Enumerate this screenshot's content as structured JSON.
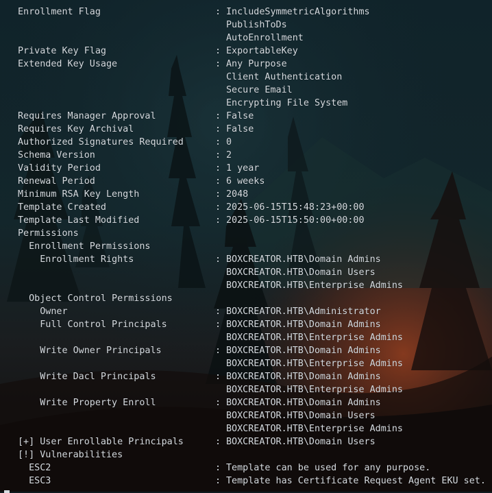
{
  "terminal": {
    "rows": [
      {
        "key": "Enrollment Flag",
        "sep": ":",
        "value": "IncludeSymmetricAlgorithms"
      },
      {
        "key": "",
        "sep": "",
        "value": "PublishToDs"
      },
      {
        "key": "",
        "sep": "",
        "value": "AutoEnrollment"
      },
      {
        "key": "Private Key Flag",
        "sep": ":",
        "value": "ExportableKey"
      },
      {
        "key": "Extended Key Usage",
        "sep": ":",
        "value": "Any Purpose"
      },
      {
        "key": "",
        "sep": "",
        "value": "Client Authentication"
      },
      {
        "key": "",
        "sep": "",
        "value": "Secure Email"
      },
      {
        "key": "",
        "sep": "",
        "value": "Encrypting File System"
      },
      {
        "key": "Requires Manager Approval",
        "sep": ":",
        "value": "False"
      },
      {
        "key": "Requires Key Archival",
        "sep": ":",
        "value": "False"
      },
      {
        "key": "Authorized Signatures Required",
        "sep": ":",
        "value": "0"
      },
      {
        "key": "Schema Version",
        "sep": ":",
        "value": "2"
      },
      {
        "key": "Validity Period",
        "sep": ":",
        "value": "1 year"
      },
      {
        "key": "Renewal Period",
        "sep": ":",
        "value": "6 weeks"
      },
      {
        "key": "Minimum RSA Key Length",
        "sep": ":",
        "value": "2048"
      },
      {
        "key": "Template Created",
        "sep": ":",
        "value": "2025-06-15T15:48:23+00:00"
      },
      {
        "key": "Template Last Modified",
        "sep": ":",
        "value": "2025-06-15T15:50:00+00:00"
      },
      {
        "key": "Permissions",
        "sep": "",
        "value": ""
      },
      {
        "key": "  Enrollment Permissions",
        "sep": "",
        "value": ""
      },
      {
        "key": "    Enrollment Rights",
        "sep": ":",
        "value": "BOXCREATOR.HTB\\Domain Admins"
      },
      {
        "key": "",
        "sep": "",
        "value": "BOXCREATOR.HTB\\Domain Users"
      },
      {
        "key": "",
        "sep": "",
        "value": "BOXCREATOR.HTB\\Enterprise Admins"
      },
      {
        "key": "  Object Control Permissions",
        "sep": "",
        "value": ""
      },
      {
        "key": "    Owner",
        "sep": ":",
        "value": "BOXCREATOR.HTB\\Administrator"
      },
      {
        "key": "    Full Control Principals",
        "sep": ":",
        "value": "BOXCREATOR.HTB\\Domain Admins"
      },
      {
        "key": "",
        "sep": "",
        "value": "BOXCREATOR.HTB\\Enterprise Admins"
      },
      {
        "key": "    Write Owner Principals",
        "sep": ":",
        "value": "BOXCREATOR.HTB\\Domain Admins"
      },
      {
        "key": "",
        "sep": "",
        "value": "BOXCREATOR.HTB\\Enterprise Admins"
      },
      {
        "key": "    Write Dacl Principals",
        "sep": ":",
        "value": "BOXCREATOR.HTB\\Domain Admins"
      },
      {
        "key": "",
        "sep": "",
        "value": "BOXCREATOR.HTB\\Enterprise Admins"
      },
      {
        "key": "    Write Property Enroll",
        "sep": ":",
        "value": "BOXCREATOR.HTB\\Domain Admins"
      },
      {
        "key": "",
        "sep": "",
        "value": "BOXCREATOR.HTB\\Domain Users"
      },
      {
        "key": "",
        "sep": "",
        "value": "BOXCREATOR.HTB\\Enterprise Admins"
      },
      {
        "key": "[+] User Enrollable Principals",
        "sep": ":",
        "value": "BOXCREATOR.HTB\\Domain Users"
      },
      {
        "key": "[!] Vulnerabilities",
        "sep": "",
        "value": ""
      },
      {
        "key": "  ESC2",
        "sep": ":",
        "value": "Template can be used for any purpose."
      },
      {
        "key": "  ESC3",
        "sep": ":",
        "value": "Template has Certificate Request Agent EKU set."
      }
    ]
  },
  "colors": {
    "text": "#d6dbe0",
    "background": "#0f1a1f",
    "accent_glow": "#a8431f"
  }
}
